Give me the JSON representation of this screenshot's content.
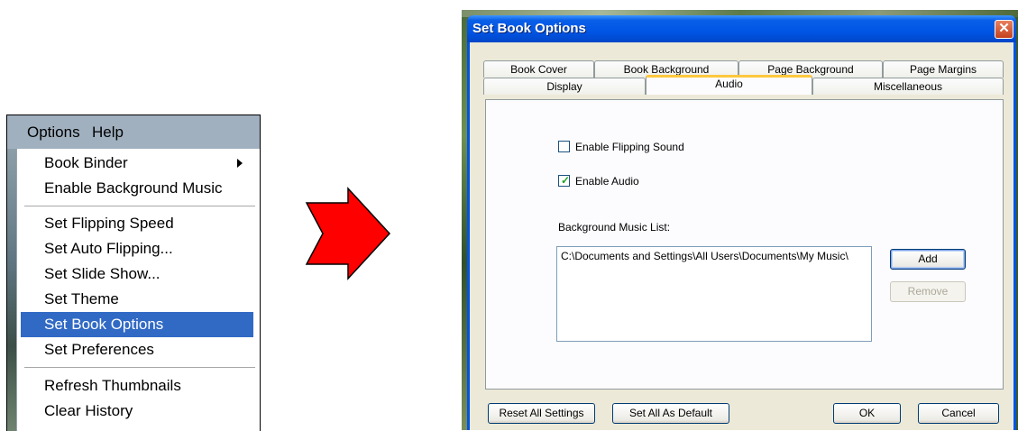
{
  "menu": {
    "menubar": {
      "options": "Options",
      "help": "Help"
    },
    "items": [
      {
        "label": "Book Binder"
      },
      {
        "label": "Enable Background Music"
      },
      {
        "label": "Set Flipping Speed"
      },
      {
        "label": "Set Auto Flipping..."
      },
      {
        "label": "Set Slide Show..."
      },
      {
        "label": "Set Theme"
      },
      {
        "label": "Set Book Options"
      },
      {
        "label": "Set Preferences"
      },
      {
        "label": "Refresh Thumbnails"
      },
      {
        "label": "Clear History"
      }
    ],
    "highlighted_item": "Set Book Options",
    "highlight_color": "#316ac5"
  },
  "arrow": {
    "color": "#ff0000",
    "icon": "right-arrow-icon"
  },
  "dialog": {
    "title": "Set Book Options",
    "close_icon": "close-icon",
    "tabs_row1": [
      "Book Cover",
      "Book Background",
      "Page Background",
      "Page Margins"
    ],
    "tabs_row2": [
      "Display",
      "Audio",
      "Miscellaneous"
    ],
    "active_tab": "Audio",
    "enable_flipping_sound": {
      "label": "Enable Flipping Sound",
      "checked": false
    },
    "enable_audio": {
      "label": "Enable Audio",
      "checked": true
    },
    "music_list_label": "Background Music List:",
    "music_list_items": [
      "C:\\Documents and Settings\\All Users\\Documents\\My Music\\"
    ],
    "add_button": "Add",
    "remove_button": "Remove",
    "reset_button": "Reset All Settings",
    "default_button": "Set All As Default",
    "ok_button": "OK",
    "cancel_button": "Cancel"
  }
}
